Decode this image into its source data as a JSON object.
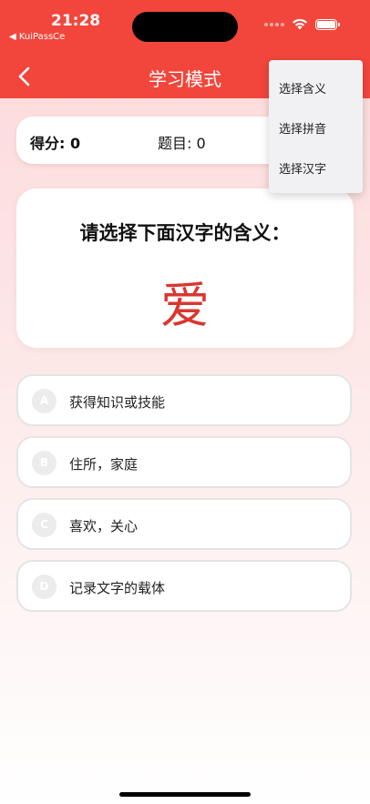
{
  "status_bar": {
    "time": "21:28",
    "back_app": "◀ KuiPassCe"
  },
  "nav": {
    "title": "学习模式"
  },
  "score_bar": {
    "score": "得分: 0",
    "question_number": "题目: 0"
  },
  "question": {
    "prompt": "请选择下面汉字的含义：",
    "character": "爱"
  },
  "options": [
    {
      "letter": "A",
      "text": "获得知识或技能"
    },
    {
      "letter": "B",
      "text": "住所，家庭"
    },
    {
      "letter": "C",
      "text": "喜欢，关心"
    },
    {
      "letter": "D",
      "text": "记录文字的载体"
    }
  ],
  "mode_menu": {
    "items": [
      "选择含义",
      "选择拼音",
      "选择汉字"
    ]
  },
  "colors": {
    "header": "#f2463c",
    "character": "#d9362f"
  }
}
